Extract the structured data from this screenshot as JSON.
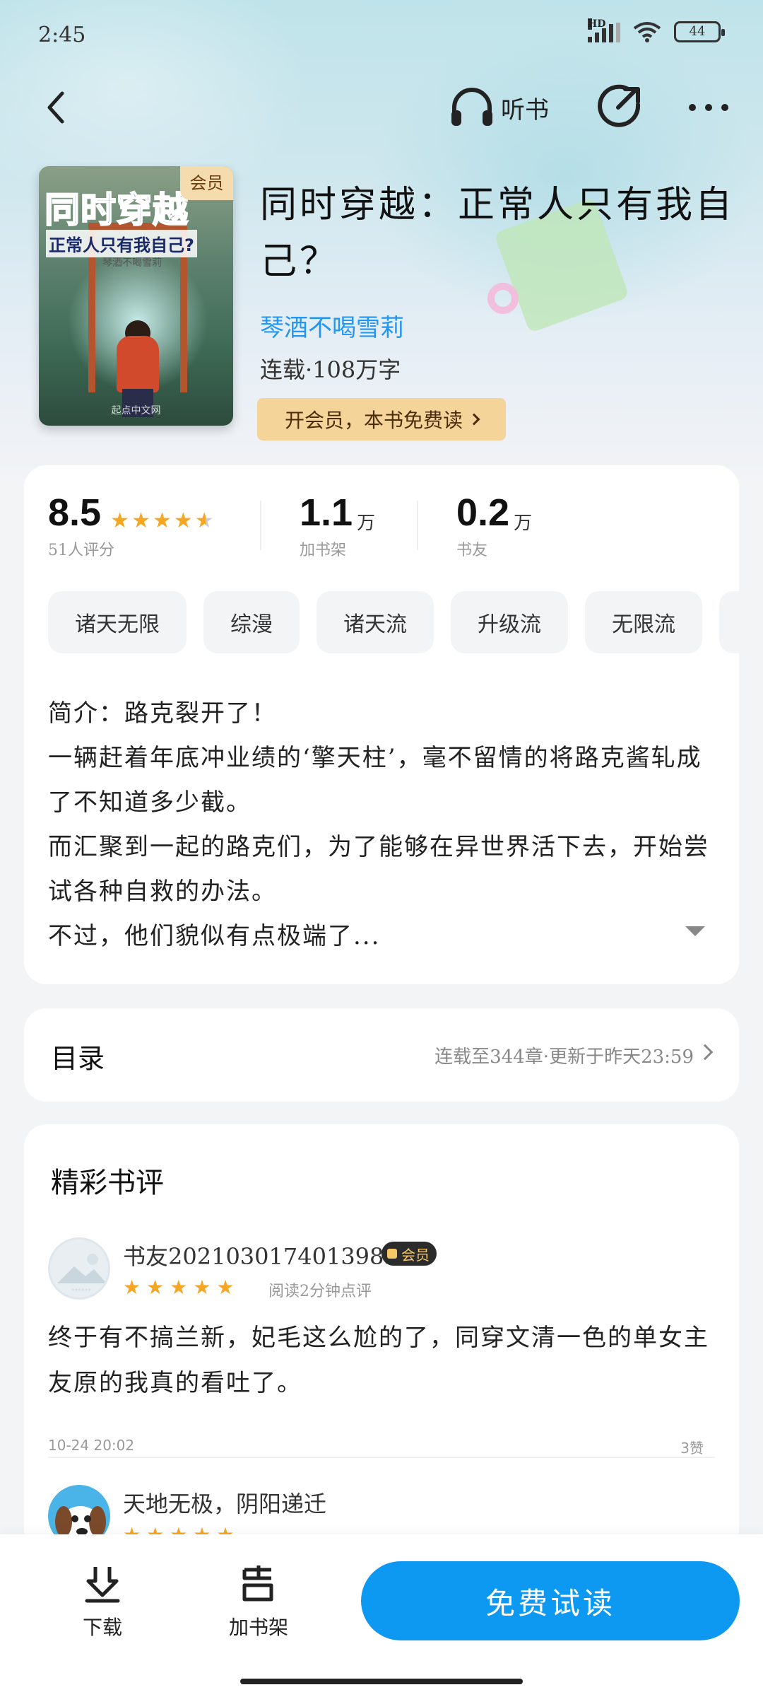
{
  "status": {
    "time": "2:45",
    "battery": "44",
    "network": "HD"
  },
  "topbar": {
    "listen_label": "听书"
  },
  "book": {
    "cover_badge": "会员",
    "cover_title": "同时穿越",
    "cover_subtitle": "正常人只有我自己?",
    "cover_author": "琴酒不喝雪莉",
    "cover_publisher": "起点中文网",
    "title": "同时穿越：正常人只有我自己？",
    "author": "琴酒不喝雪莉",
    "status": "连载·108万字",
    "vip_button": "开会员，本书免费读"
  },
  "stats": {
    "rating": "8.5",
    "rating_stars": 4.5,
    "rating_label": "51人评分",
    "shelf_num": "1.1",
    "shelf_unit": "万",
    "shelf_label": "加书架",
    "fans_num": "0.2",
    "fans_unit": "万",
    "fans_label": "书友"
  },
  "tags": [
    "诸天无限",
    "综漫",
    "诸天流",
    "升级流",
    "无限流"
  ],
  "intro": [
    "简介：路克裂开了！",
    "一辆赶着年底冲业绩的‘擎天柱’，毫不留情的将路克酱轧成了不知道多少截。",
    "而汇聚到一起的路克们，为了能够在异世界活下去，开始尝试各种自救的办法。",
    "不过，他们貌似有点极端了..."
  ],
  "toc": {
    "title": "目录",
    "info": "连载至344章·更新于昨天23:59"
  },
  "reviews": {
    "title": "精彩书评",
    "items": [
      {
        "name": "书友20210301740139831б",
        "badge": "会员",
        "stars": 5,
        "read_time": "阅读2分钟点评",
        "text": "终于有不搞兰新，妃毛这么尬的了，同穿文清一色的单女主友原的我真的看吐了。",
        "date": "10-24 20:02",
        "likes": "3赞"
      },
      {
        "name": "天地无极，阴阳递迁",
        "stars": 5
      }
    ]
  },
  "bottom": {
    "download": "下载",
    "add_shelf": "加书架",
    "read": "免费试读"
  },
  "colors": {
    "accent": "#0d98f2",
    "star": "#f5a623",
    "vip": "#f5d49a"
  }
}
